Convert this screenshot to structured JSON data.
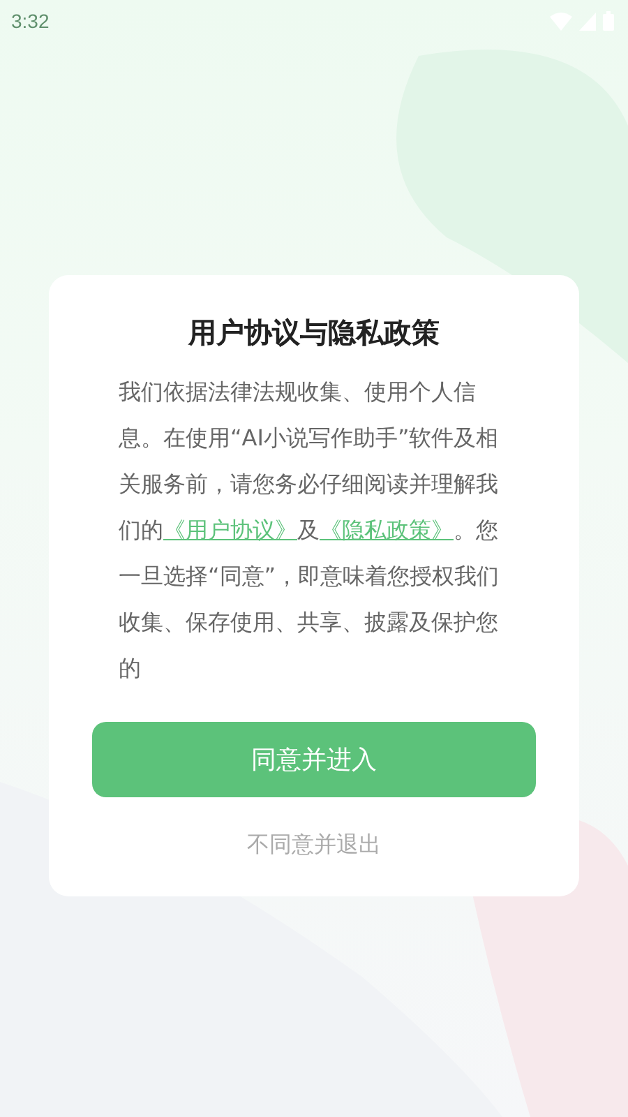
{
  "status_bar": {
    "time": "3:32"
  },
  "dialog": {
    "title": "用户协议与隐私政策",
    "body": [
      {
        "kind": "text",
        "text": "我们依据法律法规收集、使用个人信息。在使用“AI小说写作助手”软件及相关服务前，请您务必仔细阅读并理解我们的"
      },
      {
        "kind": "link",
        "text": "《用户协议》"
      },
      {
        "kind": "text",
        "text": "及"
      },
      {
        "kind": "link",
        "text": "《隐私政策》"
      },
      {
        "kind": "text",
        "text": "。您一旦选择“同意”，即意味着您授权我们收集、保存使用、共享、披露及保护您的"
      }
    ],
    "agree_button": "同意并进入",
    "decline_link": "不同意并退出"
  }
}
